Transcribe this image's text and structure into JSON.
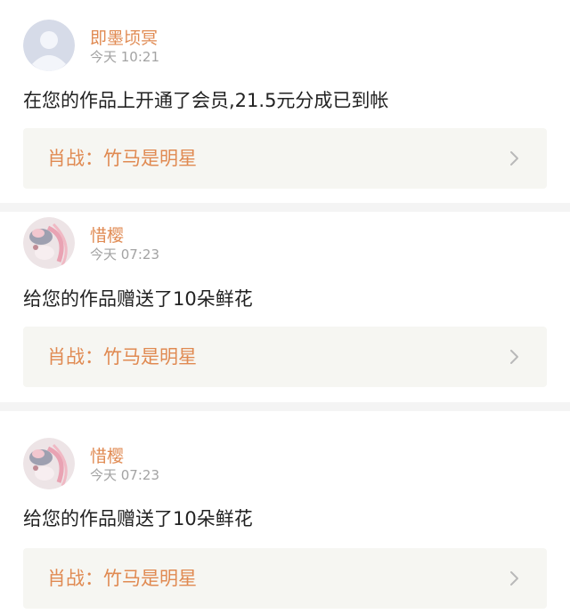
{
  "notifications": [
    {
      "username": "即墨顷冥",
      "time": "今天 10:21",
      "message": "在您的作品上开通了会员,21.5元分成已到帐",
      "work": "肖战：竹马是明星",
      "avatar_icon": "default-user-avatar"
    },
    {
      "username": "惜樱",
      "time": "今天 07:23",
      "message": "给您的作品赠送了10朵鲜花",
      "work": "肖战：竹马是明星",
      "avatar_icon": "floral-anime-avatar"
    },
    {
      "username": "惜樱",
      "time": "今天 07:23",
      "message": "给您的作品赠送了10朵鲜花",
      "work": "肖战：竹马是明星",
      "avatar_icon": "floral-anime-avatar"
    }
  ],
  "colors": {
    "username": "#e08a52",
    "work_title": "#e08a52",
    "time": "#a3a3a3",
    "message": "#222222",
    "link_background": "#f6f6f2",
    "separator": "#f4f4f4",
    "chevron": "#b9b9b9"
  }
}
